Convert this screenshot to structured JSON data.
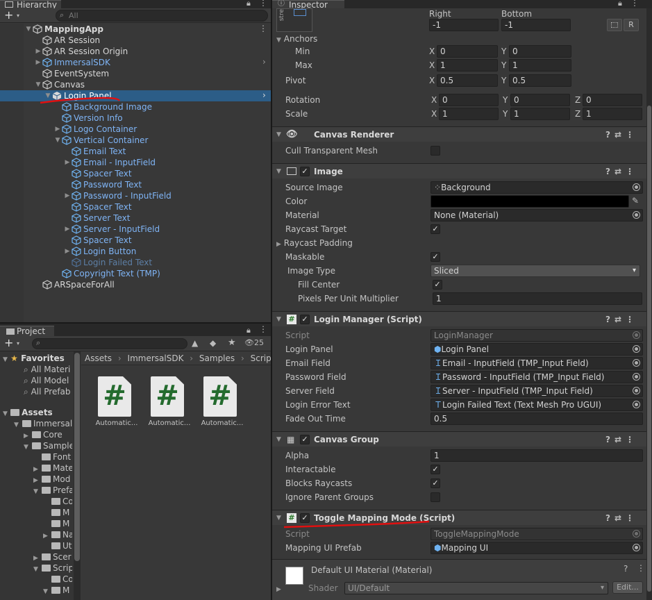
{
  "hierarchy": {
    "tab": "Hierarchy",
    "search_placeholder": "All",
    "items": [
      {
        "label": "MappingApp",
        "depth": 0,
        "arrow": "down",
        "style": "white",
        "bold": true
      },
      {
        "label": "AR Session",
        "depth": 1,
        "arrow": "",
        "style": "white"
      },
      {
        "label": "AR Session Origin",
        "depth": 1,
        "arrow": "right",
        "style": "white"
      },
      {
        "label": "ImmersalSDK",
        "depth": 1,
        "arrow": "right",
        "style": "blue"
      },
      {
        "label": "EventSystem",
        "depth": 1,
        "arrow": "",
        "style": "white"
      },
      {
        "label": "Canvas",
        "depth": 1,
        "arrow": "down",
        "style": "white"
      },
      {
        "label": "Login Panel",
        "depth": 2,
        "arrow": "down",
        "style": "white",
        "selected": true
      },
      {
        "label": "Background Image",
        "depth": 3,
        "arrow": "",
        "style": "blue"
      },
      {
        "label": "Version Info",
        "depth": 3,
        "arrow": "",
        "style": "blue"
      },
      {
        "label": "Logo Container",
        "depth": 3,
        "arrow": "right",
        "style": "blue"
      },
      {
        "label": "Vertical Container",
        "depth": 3,
        "arrow": "down",
        "style": "blue"
      },
      {
        "label": "Email Text",
        "depth": 4,
        "arrow": "",
        "style": "blue"
      },
      {
        "label": "Email - InputField",
        "depth": 4,
        "arrow": "right",
        "style": "blue"
      },
      {
        "label": "Spacer Text",
        "depth": 4,
        "arrow": "",
        "style": "blue"
      },
      {
        "label": "Password Text",
        "depth": 4,
        "arrow": "",
        "style": "blue"
      },
      {
        "label": "Password - InputField",
        "depth": 4,
        "arrow": "right",
        "style": "blue"
      },
      {
        "label": "Spacer Text",
        "depth": 4,
        "arrow": "",
        "style": "blue"
      },
      {
        "label": "Server Text",
        "depth": 4,
        "arrow": "",
        "style": "blue"
      },
      {
        "label": "Server - InputField",
        "depth": 4,
        "arrow": "right",
        "style": "blue"
      },
      {
        "label": "Spacer Text",
        "depth": 4,
        "arrow": "",
        "style": "blue"
      },
      {
        "label": "Login Button",
        "depth": 4,
        "arrow": "right",
        "style": "blue"
      },
      {
        "label": "Login Failed Text",
        "depth": 4,
        "arrow": "",
        "style": "dim"
      },
      {
        "label": "Copyright Text (TMP)",
        "depth": 3,
        "arrow": "",
        "style": "blue"
      },
      {
        "label": "ARSpaceForAll",
        "depth": 1,
        "arrow": "",
        "style": "white"
      }
    ]
  },
  "project": {
    "tab": "Project",
    "badge": "25",
    "favorites_label": "Favorites",
    "favorites": [
      "All Materi",
      "All Model",
      "All Prefab"
    ],
    "assets_label": "Assets",
    "tree": [
      {
        "label": "ImmersalS",
        "depth": 1,
        "arrow": "down"
      },
      {
        "label": "Core",
        "depth": 2,
        "arrow": "right"
      },
      {
        "label": "Sample",
        "depth": 2,
        "arrow": "down"
      },
      {
        "label": "Font",
        "depth": 3,
        "arrow": ""
      },
      {
        "label": "Mate",
        "depth": 3,
        "arrow": "right"
      },
      {
        "label": "Mod",
        "depth": 3,
        "arrow": "right"
      },
      {
        "label": "Prefa",
        "depth": 3,
        "arrow": "down"
      },
      {
        "label": "Co",
        "depth": 4,
        "arrow": ""
      },
      {
        "label": "M",
        "depth": 4,
        "arrow": ""
      },
      {
        "label": "M",
        "depth": 4,
        "arrow": ""
      },
      {
        "label": "Na",
        "depth": 4,
        "arrow": "right"
      },
      {
        "label": "Ut",
        "depth": 4,
        "arrow": ""
      },
      {
        "label": "Scer",
        "depth": 3,
        "arrow": "right"
      },
      {
        "label": "Scrip",
        "depth": 3,
        "arrow": "down"
      },
      {
        "label": "Co",
        "depth": 4,
        "arrow": ""
      },
      {
        "label": "M",
        "depth": 4,
        "arrow": "down"
      }
    ],
    "breadcrumb": [
      "Assets",
      "ImmersalSDK",
      "Samples",
      "Scripts"
    ],
    "files": [
      "Automatic...",
      "Automatic...",
      "Automatic..."
    ],
    "file_glyph": "#"
  },
  "inspector": {
    "tab": "Inspector",
    "stretch_label": "stre",
    "right_label": "Right",
    "bottom_label": "Bottom",
    "right_val": "-1",
    "bottom_val": "-1",
    "r_button": "R",
    "anchors_label": "Anchors",
    "min_label": "Min",
    "max_label": "Max",
    "min_x": "0",
    "min_y": "0",
    "max_x": "1",
    "max_y": "1",
    "pivot_label": "Pivot",
    "pivot_x": "0.5",
    "pivot_y": "0.5",
    "rotation_label": "Rotation",
    "rot_x": "0",
    "rot_y": "0",
    "rot_z": "0",
    "scale_label": "Scale",
    "scale_x": "1",
    "scale_y": "1",
    "scale_z": "1",
    "axis_x": "X",
    "axis_y": "Y",
    "axis_z": "Z",
    "canvas_renderer": {
      "title": "Canvas Renderer",
      "cull_label": "Cull Transparent Mesh"
    },
    "image": {
      "title": "Image",
      "source_label": "Source Image",
      "source_val": "Background",
      "color_label": "Color",
      "color_hex": "#000000",
      "material_label": "Material",
      "material_val": "None (Material)",
      "raycast_label": "Raycast Target",
      "padding_label": "Raycast Padding",
      "maskable_label": "Maskable",
      "type_label": "Image Type",
      "type_val": "Sliced",
      "fill_label": "Fill Center",
      "ppu_label": "Pixels Per Unit Multiplier",
      "ppu_val": "1"
    },
    "login_manager": {
      "title": "Login Manager (Script)",
      "script_label": "Script",
      "script_val": "LoginManager",
      "panel_label": "Login Panel",
      "panel_val": "Login Panel",
      "email_label": "Email Field",
      "email_val": "Email - InputField (TMP_Input Field)",
      "password_label": "Password Field",
      "password_val": "Password - InputField (TMP_Input Field)",
      "server_label": "Server Field",
      "server_val": "Server - InputField (TMP_Input Field)",
      "error_label": "Login Error Text",
      "error_val": "Login Failed Text (Text Mesh Pro UGUI)",
      "fade_label": "Fade Out Time",
      "fade_val": "0.5"
    },
    "canvas_group": {
      "title": "Canvas Group",
      "alpha_label": "Alpha",
      "alpha_val": "1",
      "interactable_label": "Interactable",
      "blocks_label": "Blocks Raycasts",
      "ignore_label": "Ignore Parent Groups"
    },
    "toggle": {
      "title": "Toggle Mapping Mode (Script)",
      "script_label": "Script",
      "script_val": "ToggleMappingMode",
      "prefab_label": "Mapping UI Prefab",
      "prefab_val": "Mapping UI"
    },
    "material": {
      "title": "Default UI Material (Material)",
      "shader_label": "Shader",
      "shader_val": "UI/Default",
      "edit_label": "Edit..."
    }
  },
  "colors": {
    "selection": "#2c5d87",
    "accent_blue": "#7fb4f5",
    "annotation_red": "#e01010"
  }
}
